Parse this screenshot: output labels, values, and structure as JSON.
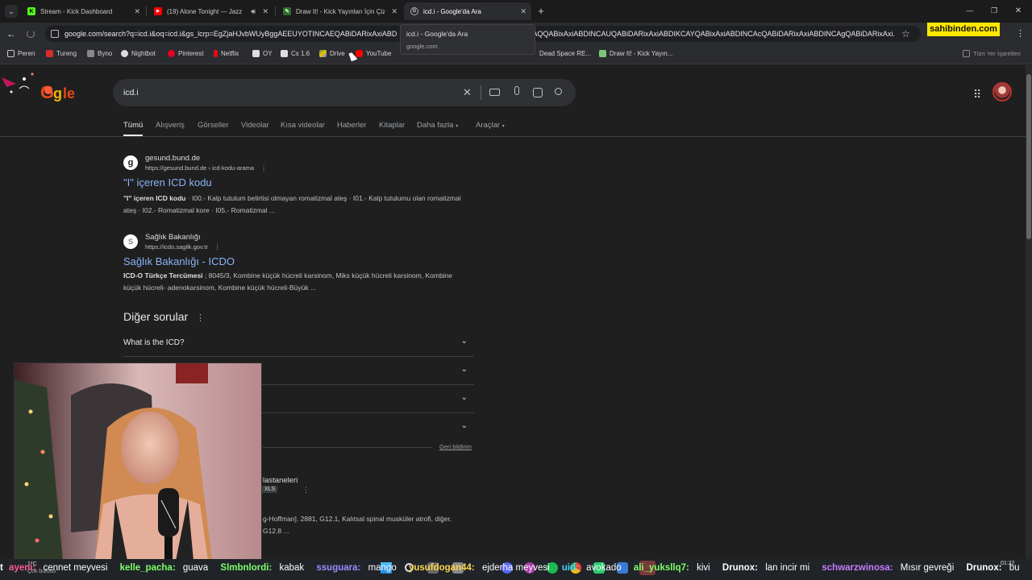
{
  "tabs": [
    {
      "label": "Stream - Kick Dashboard",
      "fav_color": "#53fc18",
      "fav_text": "K"
    },
    {
      "label": "(19) Alone Tonight — Jazz B",
      "fav_color": "#ff0000",
      "fav_text": "▶"
    },
    {
      "label": "Draw It! - Kick Yayınları İçin Çiz",
      "fav_color": "#7cc576",
      "fav_text": "✎"
    },
    {
      "label": "icd.i - Google'da Ara",
      "fav_color": "#9aa0a6",
      "fav_text": "G"
    }
  ],
  "tooltip": {
    "title": "icd.i - Google'da Ara",
    "domain": "google.com"
  },
  "address": {
    "url": "google.com/search?q=icd.i&oq=icd.i&gs_lcrp=EgZjaHJvbWUyBggAEEUYOTINCAEQABiDARixAxiABD",
    "url_tail": "AQQABixAxiABDINCAUQABiDARixAxiABDIKCAYQABixAxiABDINCAcQABiDARixAxiABDINCAgQABiDARixAxi..."
  },
  "sahibinden": "sahibinden.com",
  "bookmarks": [
    {
      "label": "Peren",
      "color": "#cfcfcf"
    },
    {
      "label": "Tureng",
      "color": "#d32f2f"
    },
    {
      "label": "Byno",
      "color": "#cfcfcf"
    },
    {
      "label": "Nightbot",
      "color": "#cfcfcf"
    },
    {
      "label": "Pinterest",
      "color": "#e60023"
    },
    {
      "label": "Netflix",
      "color": "#e50914"
    },
    {
      "label": "OY",
      "color": "#d9d9d9"
    },
    {
      "label": "Cs 1.6",
      "color": "#d9d9d9"
    },
    {
      "label": "Drive",
      "color": "#34a853"
    },
    {
      "label": "YouTube",
      "color": "#ff0000"
    },
    {
      "label": "Dead Space RE...",
      "color": "#cfcfcf"
    },
    {
      "label": "Draw It! - Kick Yayın...",
      "color": "#7cc576"
    },
    {
      "label": "Tüm Yer İşaretleri",
      "color": "#cfcfcf"
    }
  ],
  "search": {
    "query": "icd.i"
  },
  "nav_tabs": [
    "Tümü",
    "Alışveriş",
    "Görseller",
    "Videolar",
    "Kısa videolar",
    "Haberler",
    "Kitaplar",
    "Daha fazla",
    "Araçlar"
  ],
  "results": [
    {
      "site": "gesund.bund.de",
      "url": "https://gesund.bund.de › icd-kodu-arama",
      "title": "\"I\" içeren ICD kodu",
      "snippet_bold": "\"I\" içeren ICD kodu",
      "snippet": " · I00.- Kalp tutulum belirtisi olmayan romatizmal ateş · I01.- Kalp tutulumu olan romatizmal ateş · I02.- Romatizmal kore · I05.- Romatizmal ...",
      "icon_text": "g"
    },
    {
      "site": "Sağlık Bakanlığı",
      "url": "https://icdo.saglik.gov.tr",
      "title": "Sağlık Bakanlığı - ICDO",
      "snippet_bold": "ICD-O Türkçe Tercümesi",
      "snippet": " ; 8045/3, Kombine küçük hücreli karsinom, Miks küçük hücreli karsinom, Kombine küçük hücreli- adenokarsinom, Kombine küçük hücreli-Büyük ...",
      "icon_text": "S"
    }
  ],
  "questions": {
    "heading": "Diğer sorular",
    "items": [
      "What is the ICD?"
    ],
    "feedback": "Geri bildirim"
  },
  "partial_result": {
    "site_fragment": "lastaneleri",
    "badge": "XLS",
    "snippet_line1": "g-Hoffman]. 2881, G12.1, Kalıtsal spinal musküler atrofi, diğer.",
    "snippet_line2": "G12.8 ..."
  },
  "ticker": [
    {
      "user": "ayeni:",
      "msg": "cennet meyvesi",
      "color": "#ff5c93"
    },
    {
      "user": "kelle_pacha:",
      "msg": "guava",
      "color": "#7dff6a"
    },
    {
      "user": "Slmbnlordi:",
      "msg": "kabak",
      "color": "#7dff6a"
    },
    {
      "user": "ssuguara:",
      "msg": "mango",
      "color": "#9b8cff"
    },
    {
      "user": "yusufdogan44:",
      "msg": "ejderha meyvesi",
      "color": "#ffd64d"
    },
    {
      "user": "uid:",
      "msg": "avokado",
      "color": "#4dd0ff"
    },
    {
      "user": "ali_yuksllq7:",
      "msg": "kivi",
      "color": "#7dff6a"
    },
    {
      "user": "Drunox:",
      "msg": "lan incir mi",
      "color": "#ffffff"
    },
    {
      "user": "schwarzwinosa:",
      "msg": "Mısır gevreği",
      "color": "#c77dff"
    },
    {
      "user": "Drunox:",
      "msg": "bu",
      "color": "#ffffff"
    }
  ],
  "taskbar": {
    "weather": "1°C",
    "weather_sub": "Çok bulutlu",
    "time": "01:22",
    "date": "..."
  }
}
